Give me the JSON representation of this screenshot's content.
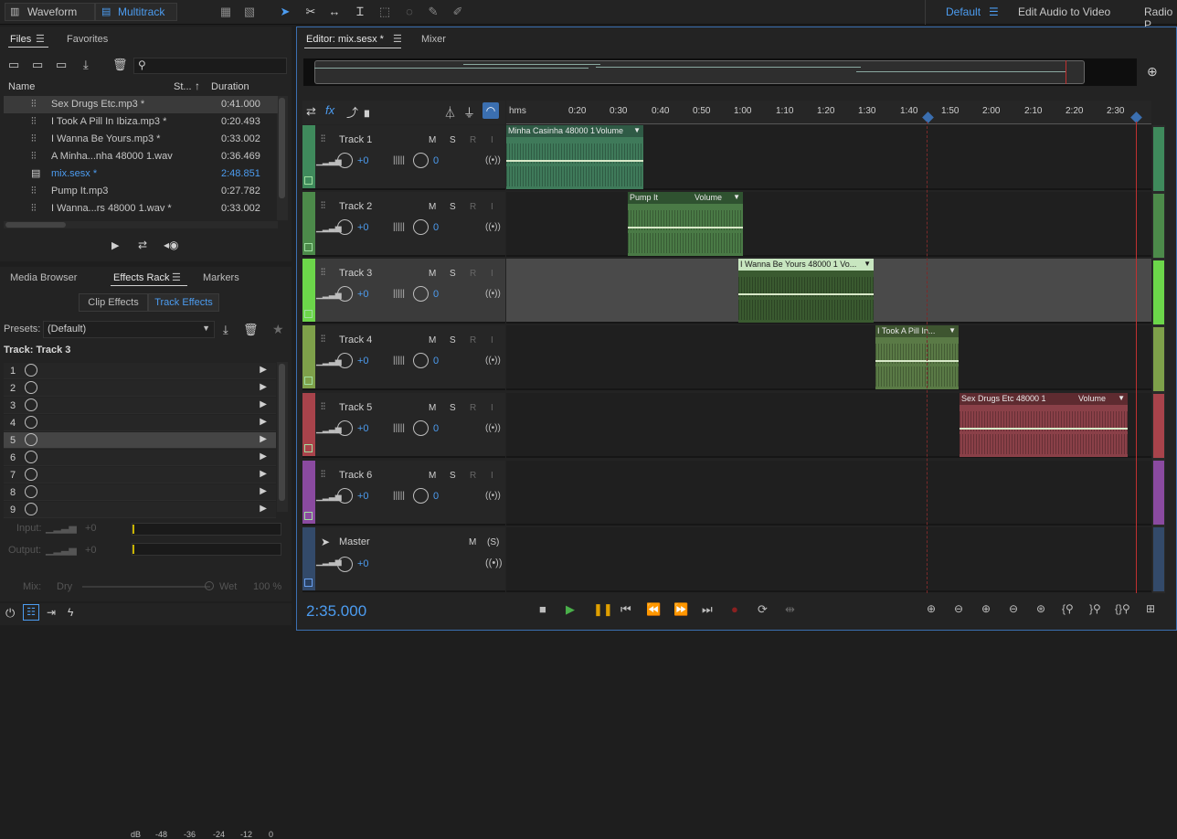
{
  "topbar": {
    "waveform_label": "Waveform",
    "multitrack_label": "Multitrack",
    "workspace_default": "Default",
    "workspace_edit": "Edit Audio to Video",
    "workspace_radio": "Radio P"
  },
  "files_panel": {
    "tab_files": "Files",
    "tab_favorites": "Favorites",
    "col_name": "Name",
    "col_status": "St...",
    "col_duration": "Duration",
    "rows": [
      {
        "name": "Sex Drugs Etc.mp3 *",
        "duration": "0:41.000",
        "selected": true
      },
      {
        "name": "I Took A Pill In Ibiza.mp3 *",
        "duration": "0:20.493"
      },
      {
        "name": "I Wanna Be Yours.mp3 *",
        "duration": "0:33.002"
      },
      {
        "name": "A Minha...nha 48000 1.wav",
        "duration": "0:36.469"
      },
      {
        "name": "mix.sesx *",
        "duration": "2:48.851",
        "highlight": true
      },
      {
        "name": "Pump It.mp3",
        "duration": "0:27.782"
      },
      {
        "name": "I Wanna...rs 48000 1.wav *",
        "duration": "0:33.002"
      }
    ]
  },
  "effects_panel": {
    "tab_media": "Media Browser",
    "tab_effects": "Effects Rack",
    "tab_markers": "Markers",
    "clip_effects": "Clip Effects",
    "track_effects": "Track Effects",
    "presets_label": "Presets:",
    "presets_value": "(Default)",
    "track_label": "Track: Track 3",
    "slots": [
      "1",
      "2",
      "3",
      "4",
      "5",
      "6",
      "7",
      "8",
      "9"
    ],
    "input_label": "Input:",
    "input_value": "+0",
    "output_label": "Output:",
    "output_value": "+0",
    "db_ticks": [
      "dB",
      "-48",
      "-36",
      "-24",
      "-12",
      "0"
    ],
    "mix_label": "Mix:",
    "dry_label": "Dry",
    "wet_label": "Wet",
    "wet_value": "100 %"
  },
  "editor": {
    "tab_editor": "Editor: mix.sesx *",
    "tab_mixer": "Mixer",
    "ruler_labels": [
      "hms",
      "0:20",
      "0:30",
      "0:40",
      "0:50",
      "1:00",
      "1:10",
      "1:20",
      "1:30",
      "1:40",
      "1:50",
      "2:00",
      "2:10",
      "2:20",
      "2:30"
    ],
    "time_display": "2:35.000",
    "tracks": [
      {
        "name": "Track 1",
        "vol": "+0",
        "pan": "0",
        "color": "#3f8a5c"
      },
      {
        "name": "Track 2",
        "vol": "+0",
        "pan": "0",
        "color": "#4c8a4a"
      },
      {
        "name": "Track 3",
        "vol": "+0",
        "pan": "0",
        "color": "#6cd64a"
      },
      {
        "name": "Track 4",
        "vol": "+0",
        "pan": "0",
        "color": "#7ea04a"
      },
      {
        "name": "Track 5",
        "vol": "+0",
        "pan": "0",
        "color": "#a8434b"
      },
      {
        "name": "Track 6",
        "vol": "+0",
        "pan": "0",
        "color": "#8a4aa0"
      }
    ],
    "master": {
      "name": "Master",
      "vol": "+0",
      "m": "M",
      "s": "(S)"
    },
    "msri": {
      "m": "M",
      "s": "S",
      "r": "R",
      "i": "I"
    },
    "clips": [
      {
        "title": "Minha Casinha 48000 1",
        "vol": "Volume"
      },
      {
        "title": "Pump It",
        "vol": "Volume"
      },
      {
        "title": "I Wanna Be Yours 48000 1 Vo...",
        "vol": ""
      },
      {
        "title": "I Took A Pill In...",
        "vol": ""
      },
      {
        "title": "Sex Drugs Etc 48000 1",
        "vol": "Volume"
      }
    ]
  }
}
